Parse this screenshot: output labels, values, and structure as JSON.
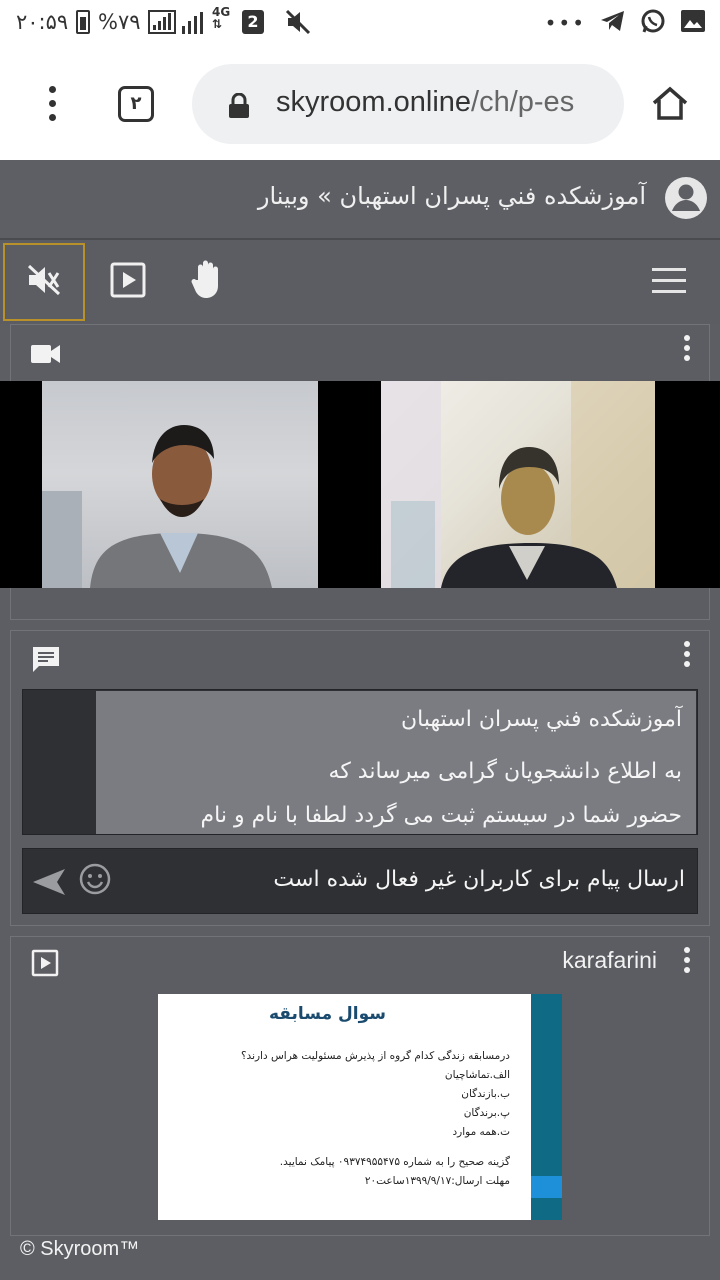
{
  "status_bar": {
    "time": "۲۰:۵۹",
    "battery": "%۷۹",
    "network": "4G",
    "sim": "2"
  },
  "browser": {
    "tab_count": "۲",
    "url_host": "skyroom.online",
    "url_path": "/ch/p-es"
  },
  "room": {
    "title": "آموزشکده فني پسران استهبان » وبینار"
  },
  "chat": {
    "messages": [
      "آموزشکده فني پسران استهبان",
      "به اطلاع دانشجویان گرامی میرساند که",
      "حضور شما در سیستم ثبت می گردد لطفا با نام و نام"
    ],
    "disabled_notice": "ارسال پیام برای کاربران غیر فعال شده است"
  },
  "slide_panel": {
    "name": "karafarini",
    "slide": {
      "title": "سوال مسابقه",
      "question": "درمسابقه زندگی کدام گروه از پذیرش مسئولیت هراس دارند؟",
      "options": [
        "الف.تماشاچیان",
        "ب.بازندگان",
        "پ.برندگان",
        "ت.همه موارد"
      ],
      "instruction": "گزینه صحیح را به شماره ۰۹۳۷۴۹۵۵۴۷۵ پیامک نمایید.",
      "deadline": "مهلت ارسال:۱۳۹۹/۹/۱۷ساعت۲۰"
    }
  },
  "footer": "© Skyroom™",
  "colors": {
    "panel_bg": "#5c5d62",
    "accent_border": "#b8912a",
    "slide_bar": "#0f6a86"
  }
}
